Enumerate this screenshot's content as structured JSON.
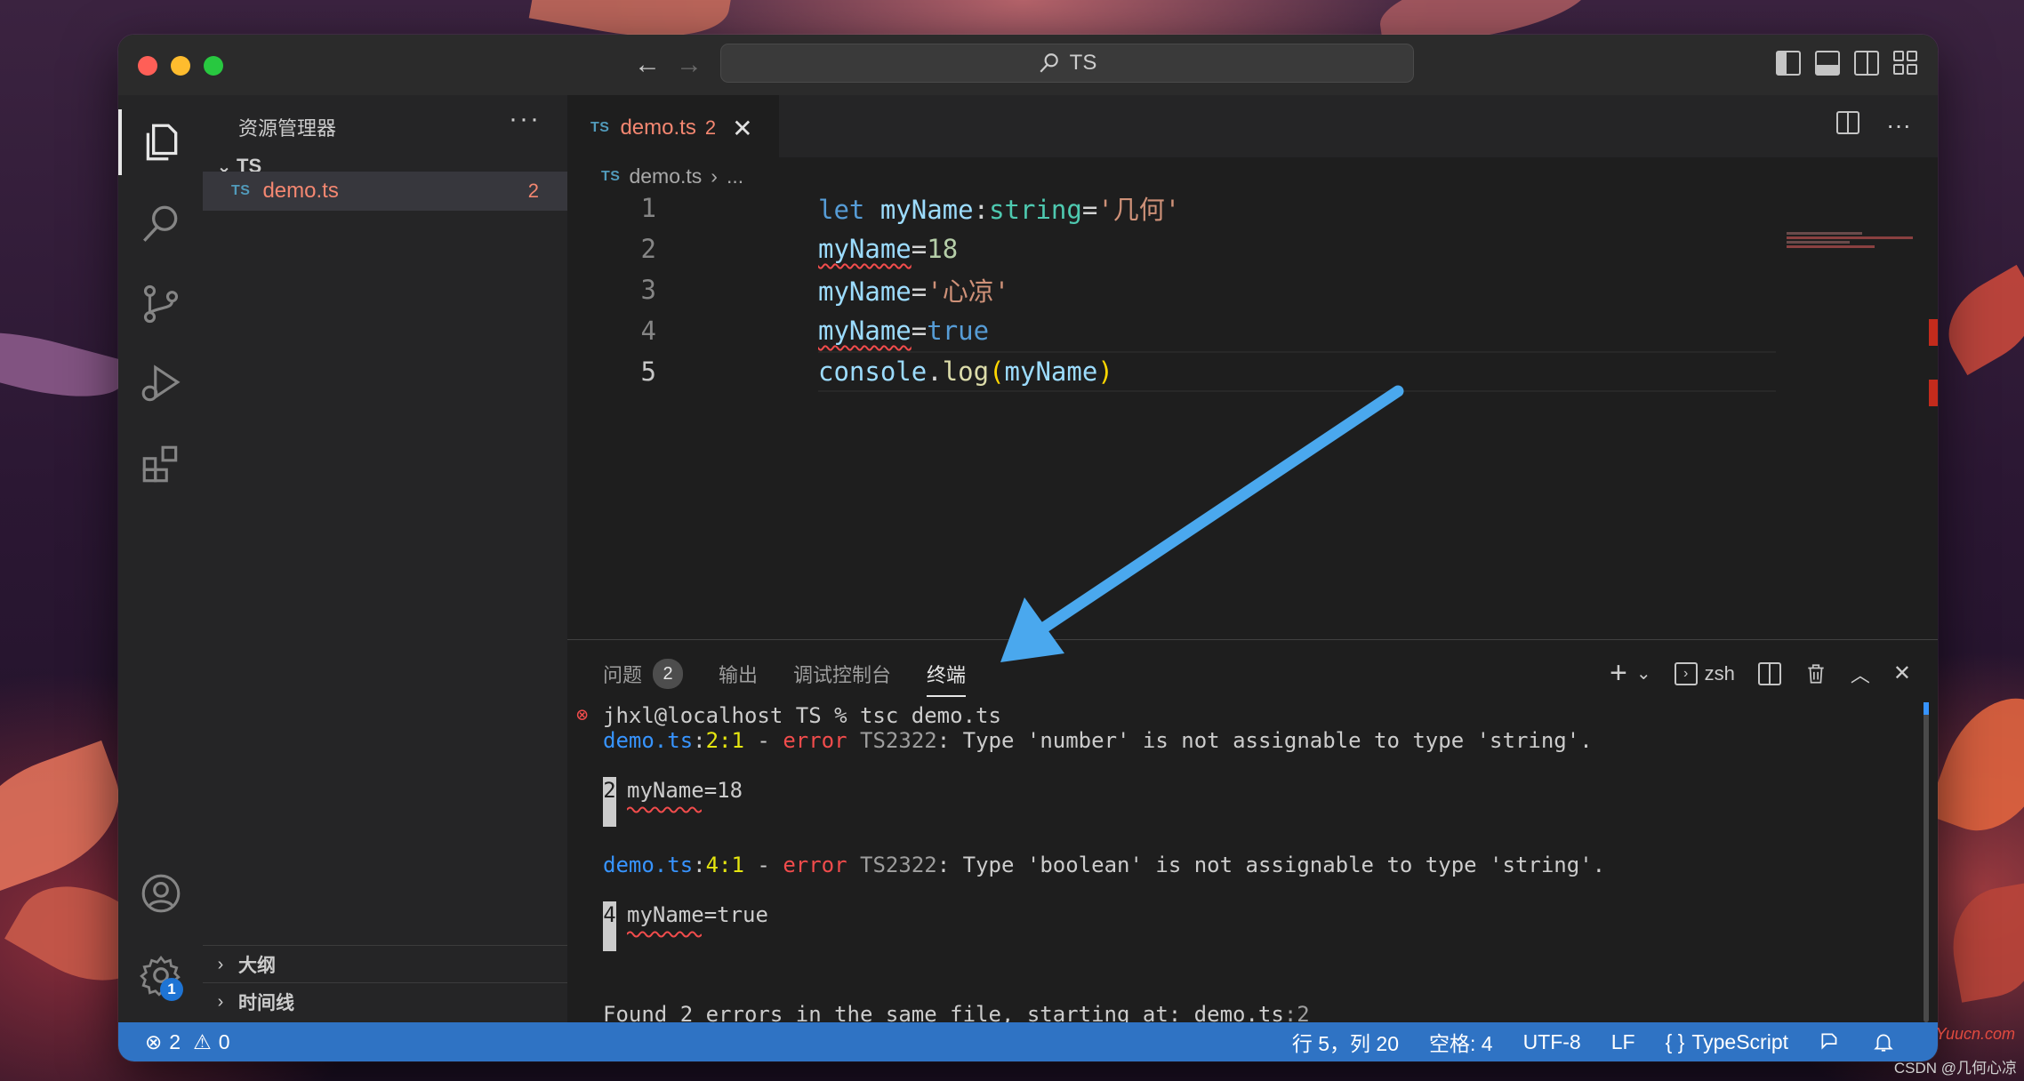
{
  "window": {
    "search_text": "TS"
  },
  "sidebar": {
    "title": "资源管理器",
    "more": "···",
    "folder": "TS",
    "file": {
      "badge": "TS",
      "name": "demo.ts",
      "problems": "2"
    },
    "sections": [
      "大纲",
      "时间线"
    ]
  },
  "activity": {
    "settings_badge": "1"
  },
  "editor": {
    "tab": {
      "badge": "TS",
      "name": "demo.ts",
      "count": "2",
      "close": "✕"
    },
    "more": "···",
    "breadcrumb": {
      "badge": "TS",
      "file": "demo.ts",
      "sep": "›",
      "rest": "..."
    },
    "line_numbers": [
      "1",
      "2",
      "3",
      "4",
      "5"
    ],
    "lines": {
      "l1": {
        "kw": "let ",
        "var": "myName",
        "colon": ":",
        "type": "string",
        "eq": "=",
        "str": "'几何'"
      },
      "l2": {
        "var": "myName",
        "eq": "=",
        "num": "18"
      },
      "l3": {
        "var": "myName",
        "eq": "=",
        "str": "'心凉'"
      },
      "l4": {
        "var": "myName",
        "eq": "=",
        "kw": "true"
      },
      "l5": {
        "obj": "console",
        "dot": ".",
        "fn": "log",
        "open": "(",
        "arg": "myName",
        "close": ")"
      }
    }
  },
  "panel": {
    "tabs": [
      {
        "label": "问题",
        "badge": "2"
      },
      {
        "label": "输出"
      },
      {
        "label": "调试控制台"
      },
      {
        "label": "终端"
      }
    ],
    "actions": {
      "add": "+",
      "dropdown": "⌄",
      "shell": "zsh",
      "shell_glyph": "›",
      "up": "︿",
      "close": "✕"
    },
    "terminal": {
      "prompt": "jhxl@localhost TS % tsc demo.ts",
      "e1": {
        "file": "demo.ts",
        "sep": ":",
        "pos": "2:1",
        "dash": " - ",
        "err": "error",
        "code": " TS2322",
        "msg": ": Type 'number' is not assignable to type 'string'."
      },
      "snip1": {
        "num": "2",
        "code": "myName=18"
      },
      "e2": {
        "file": "demo.ts",
        "sep": ":",
        "pos": "4:1",
        "dash": " - ",
        "err": "error",
        "code": " TS2322",
        "msg": ": Type 'boolean' is not assignable to type 'string'."
      },
      "snip2": {
        "num": "4",
        "code": "myName=true"
      },
      "found": {
        "text": "Found 2 errors in the same file, starting at: demo.ts",
        "pos": ":2"
      }
    }
  },
  "status": {
    "errors": "2",
    "warnings": "0",
    "position": "行 5，列 20",
    "spaces": "空格: 4",
    "encoding": "UTF-8",
    "eol": "LF",
    "lang_icon": "{ }",
    "language": "TypeScript"
  },
  "watermark": {
    "csdn": "CSDN @几何心凉",
    "yuucn": "Yuucn.com"
  }
}
